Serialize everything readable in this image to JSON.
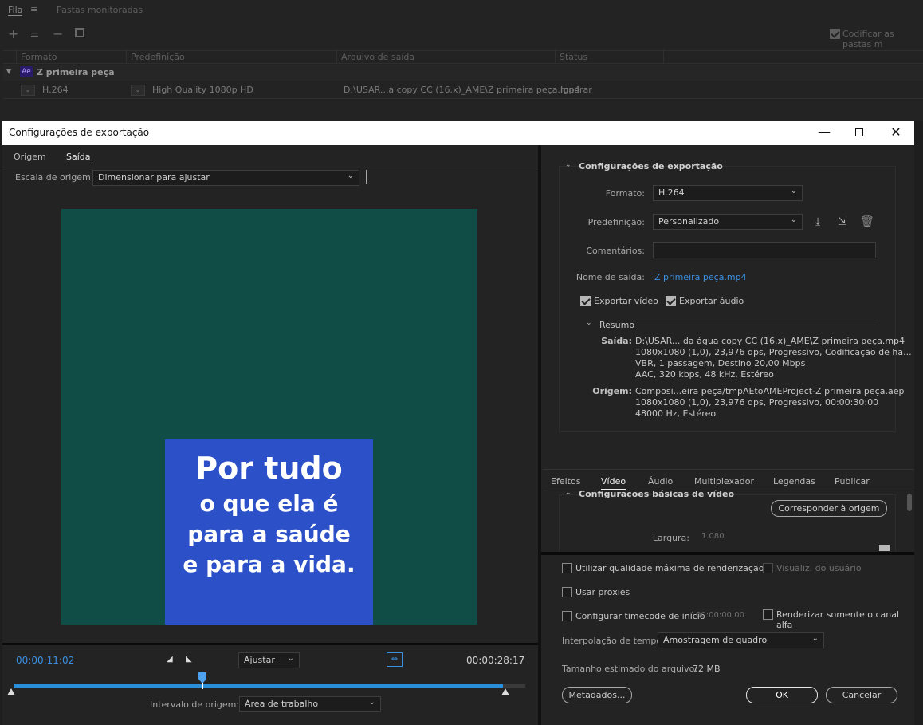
{
  "bg": {
    "tabs": [
      "Fila",
      "Pastas monitoradas"
    ],
    "auto_encode": "Codificar as pastas m",
    "columns": [
      "Formato",
      "Predefinição",
      "Arquivo de saída",
      "Status"
    ],
    "group_badge": "Ae",
    "group_name": "Z primeira peça",
    "row": {
      "format": "H.264",
      "preset": "High Quality 1080p HD",
      "output": "D:\\USAR...a copy CC (16.x)_AME\\Z primeira peça.mp4",
      "status": "Ignorar"
    }
  },
  "dialog": {
    "title": "Configurações de exportação",
    "left": {
      "tabs": [
        "Origem",
        "Saída"
      ],
      "scale_label": "Escala de origem:",
      "scale_value": "Dimensionar para ajustar",
      "preview_lines": [
        "Por tudo",
        "o que ela é",
        "para a saúde",
        "e para a vida."
      ],
      "time_current": "00:00:11:02",
      "time_total": "00:00:28:17",
      "fit_value": "Ajustar",
      "range_label": "Intervalo de origem:",
      "range_value": "Área de trabalho"
    },
    "right": {
      "section_export": "Configurações de exportação",
      "format_label": "Formato:",
      "format_value": "H.264",
      "preset_label": "Predefinição:",
      "preset_value": "Personalizado",
      "comments_label": "Comentários:",
      "comments_value": "",
      "output_label": "Nome de saída:",
      "output_value": "Z primeira peça.mp4",
      "export_video": "Exportar vídeo",
      "export_audio": "Exportar áudio",
      "summary_title": "Resumo",
      "summary_output_label": "Saída:",
      "summary_output": [
        "D:\\USAR... da água copy CC (16.x)_AME\\Z primeira peça.mp4",
        "1080x1080 (1,0), 23,976 qps, Progressivo, Codificação de ha...",
        "VBR, 1 passagem, Destino 20,00 Mbps",
        "AAC, 320 kbps, 48 kHz, Estéreo"
      ],
      "summary_source_label": "Origem:",
      "summary_source": [
        "Composi...eira peça/tmpAEtoAMEProject-Z primeira peça.aep",
        "1080x1080 (1,0), 23,976 qps, Progressivo, 00:00:30:00",
        "48000 Hz, Estéreo"
      ],
      "tabs": [
        "Efeitos",
        "Vídeo",
        "Áudio",
        "Multiplexador",
        "Legendas",
        "Publicar"
      ],
      "basic_video": "Configurações básicas de vídeo",
      "match_source": "Corresponder à origem",
      "width_label": "Largura:",
      "width_value": "1.080",
      "max_quality": "Utilizar qualidade máxima de renderização",
      "user_view": "Visualiz. do usuário",
      "use_proxies": "Usar proxies",
      "timecode": "Configurar timecode de início",
      "timecode_value": "00:00:00:00",
      "alpha_only": "Renderizar somente o canal alfa",
      "interp_label": "Interpolação de tempo:",
      "interp_value": "Amostragem de quadro",
      "size_label": "Tamanho estimado do arquivo:",
      "size_value": "72 MB",
      "metadata_btn": "Metadados...",
      "ok_btn": "OK",
      "cancel_btn": "Cancelar"
    }
  }
}
